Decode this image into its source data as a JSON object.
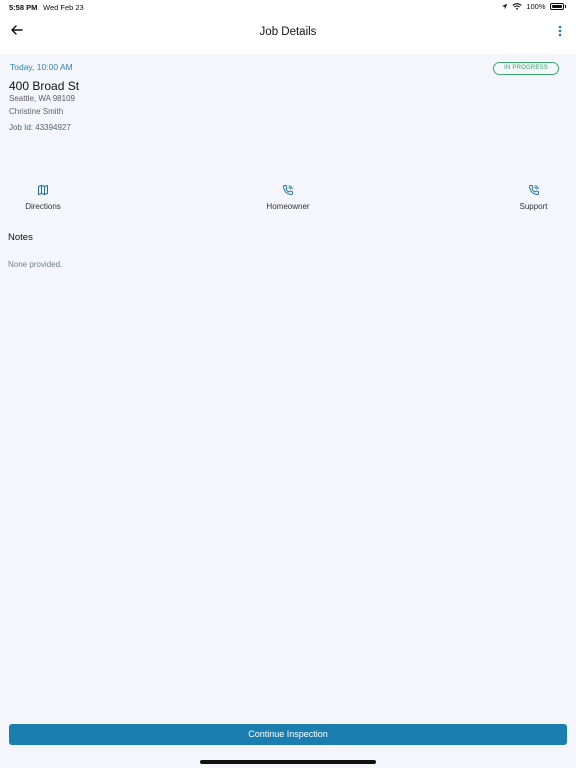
{
  "status_bar": {
    "time": "5:58 PM",
    "date": "Wed Feb 23",
    "battery": "100%"
  },
  "nav": {
    "title": "Job Details",
    "back_icon": "arrow-left-icon",
    "more_icon": "vertical-dots-icon"
  },
  "job": {
    "time": "Today, 10:00 AM",
    "status": "IN PROGRESS",
    "address": "400 Broad St",
    "city": "Seattle, WA 98109",
    "contact": "Christine Smith",
    "job_id": "Job Id: 43394927"
  },
  "actions": [
    {
      "label": "Directions",
      "icon": "map-icon"
    },
    {
      "label": "Homeowner",
      "icon": "phone-icon"
    },
    {
      "label": "Support",
      "icon": "phone-icon"
    }
  ],
  "notes": {
    "heading": "Notes",
    "body": "None provided."
  },
  "footer": {
    "continue_label": "Continue Inspection"
  },
  "colors": {
    "accent": "#1a7fb0",
    "link_blue": "#2e86b7",
    "status_green": "#3aa66a",
    "background": "#f4f6fb"
  }
}
